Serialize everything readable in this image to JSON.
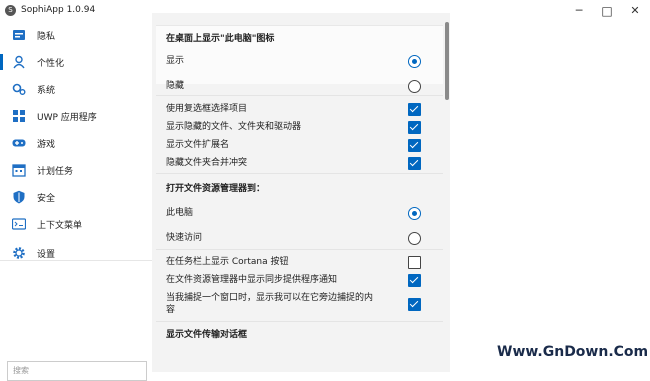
{
  "window": {
    "title": "SophiApp 1.0.94",
    "app_icon_glyph": "S",
    "minimize_glyph": "─",
    "maximize_glyph": "□",
    "close_glyph": "✕"
  },
  "sidebar": {
    "items": [
      {
        "label": "隐私",
        "icon": "privacy-icon",
        "color": "#2b6cb0"
      },
      {
        "label": "个性化",
        "icon": "personalization-icon",
        "color": "#2b6cb0",
        "active": true
      },
      {
        "label": "系统",
        "icon": "system-icon",
        "color": "#2b6cb0"
      },
      {
        "label": "UWP 应用程序",
        "icon": "uwp-apps-icon",
        "color": "#2b6cb0"
      },
      {
        "label": "游戏",
        "icon": "gamepad-icon",
        "color": "#2b6cb0"
      },
      {
        "label": "计划任务",
        "icon": "scheduled-tasks-icon",
        "color": "#2b6cb0"
      },
      {
        "label": "安全",
        "icon": "shield-icon",
        "color": "#2b6cb0"
      },
      {
        "label": "上下文菜单",
        "icon": "context-menu-icon",
        "color": "#2b6cb0"
      },
      {
        "label": "设置",
        "icon": "gear-icon",
        "color": "#2b6cb0"
      }
    ],
    "search_placeholder": "搜索"
  },
  "content": {
    "section1": {
      "title": "在桌面上显示\"此电脑\"图标",
      "options": [
        {
          "label": "显示",
          "type": "radio",
          "checked": true
        },
        {
          "label": "隐藏",
          "type": "radio",
          "checked": false
        }
      ]
    },
    "checks1": [
      {
        "label": "使用复选框选择项目",
        "checked": true
      },
      {
        "label": "显示隐藏的文件、文件夹和驱动器",
        "checked": true
      },
      {
        "label": "显示文件扩展名",
        "checked": true
      },
      {
        "label": "隐藏文件夹合并冲突",
        "checked": true
      }
    ],
    "section2": {
      "title": "打开文件资源管理器到：",
      "options": [
        {
          "label": "此电脑",
          "type": "radio",
          "checked": true
        },
        {
          "label": "快速访问",
          "type": "radio",
          "checked": false
        }
      ]
    },
    "checks2": [
      {
        "label": "在任务栏上显示 Cortana 按钮",
        "checked": false
      },
      {
        "label": "在文件资源管理器中显示同步提供程序通知",
        "checked": true
      },
      {
        "label_line1": "当我捕捉一个窗口时，显示我可以在它旁边捕捉的内",
        "label_line2": "容",
        "checked": true
      }
    ],
    "section3": {
      "title": "显示文件传输对话框"
    }
  },
  "watermark": "Www.GnDown.Com",
  "colors": {
    "accent": "#0067c0",
    "content_bg": "#f3f3f3",
    "card_bg": "#fbfbfb"
  }
}
